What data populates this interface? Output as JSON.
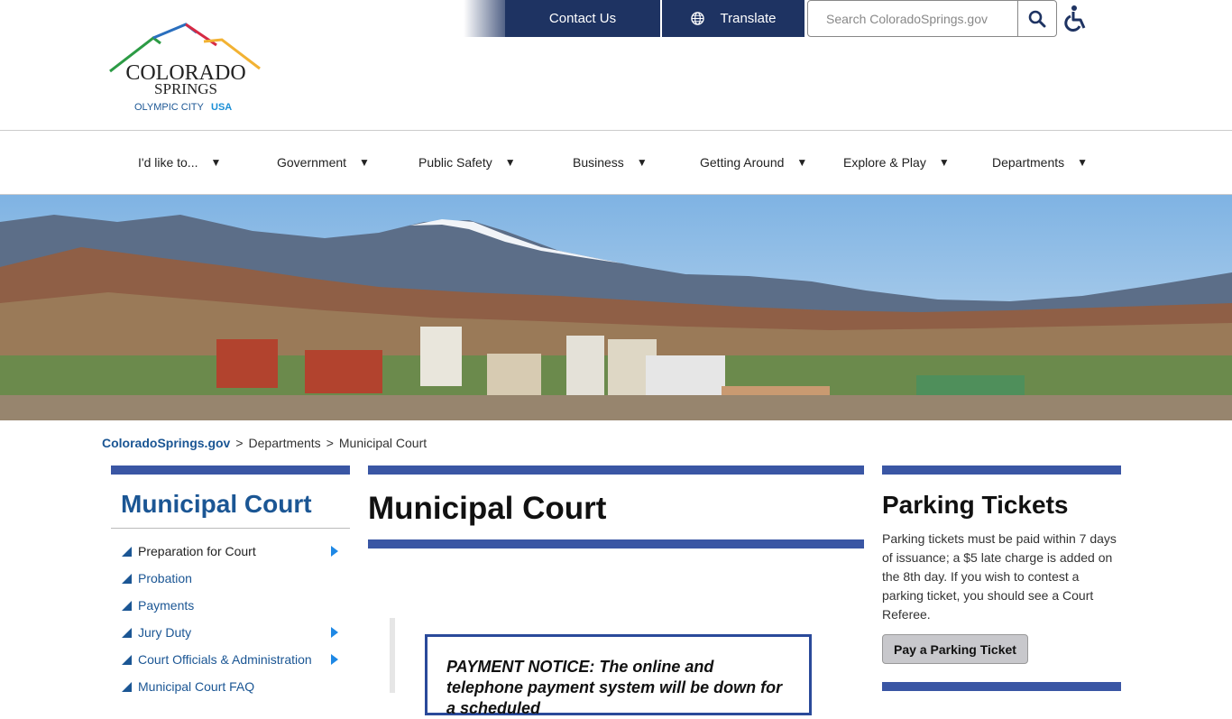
{
  "header": {
    "contact_label": "Contact Us",
    "translate_label": "Translate",
    "search_placeholder": "Search ColoradoSprings.gov",
    "logo": {
      "line1": "COLORADO",
      "line2": "SPRINGS",
      "tagline_1": "OLYMPIC CITY",
      "tagline_2": "USA"
    }
  },
  "nav": {
    "items": [
      {
        "label": "I'd like to..."
      },
      {
        "label": "Government"
      },
      {
        "label": "Public Safety"
      },
      {
        "label": "Business"
      },
      {
        "label": "Getting Around"
      },
      {
        "label": "Explore & Play"
      },
      {
        "label": "Departments"
      }
    ],
    "caret": "▼"
  },
  "breadcrumb": {
    "home": "ColoradoSprings.gov",
    "sep": ">",
    "level1": "Departments",
    "level2": "Municipal Court"
  },
  "sidebar": {
    "title": "Municipal Court",
    "items": [
      {
        "label": "Preparation for Court"
      },
      {
        "label": "Probation"
      },
      {
        "label": "Payments"
      },
      {
        "label": "Jury Duty"
      },
      {
        "label": "Court Officials & Administration"
      },
      {
        "label": "Municipal Court FAQ"
      }
    ]
  },
  "main": {
    "title": "Municipal Court",
    "notice": "PAYMENT NOTICE: The online and telephone payment system will be down for a scheduled"
  },
  "right": {
    "title": "Parking Tickets",
    "text": "Parking tickets must be paid within 7 days of issuance; a $5 late charge is added on the 8th day. If you wish to contest a parking ticket, you should see a Court Referee.",
    "button": "Pay a Parking Ticket"
  },
  "colors": {
    "nav_dark": "#1e3362",
    "accent_bar": "#3a56a4",
    "link_blue": "#1b5694",
    "sidebar_arrow": "#1e88e5"
  }
}
